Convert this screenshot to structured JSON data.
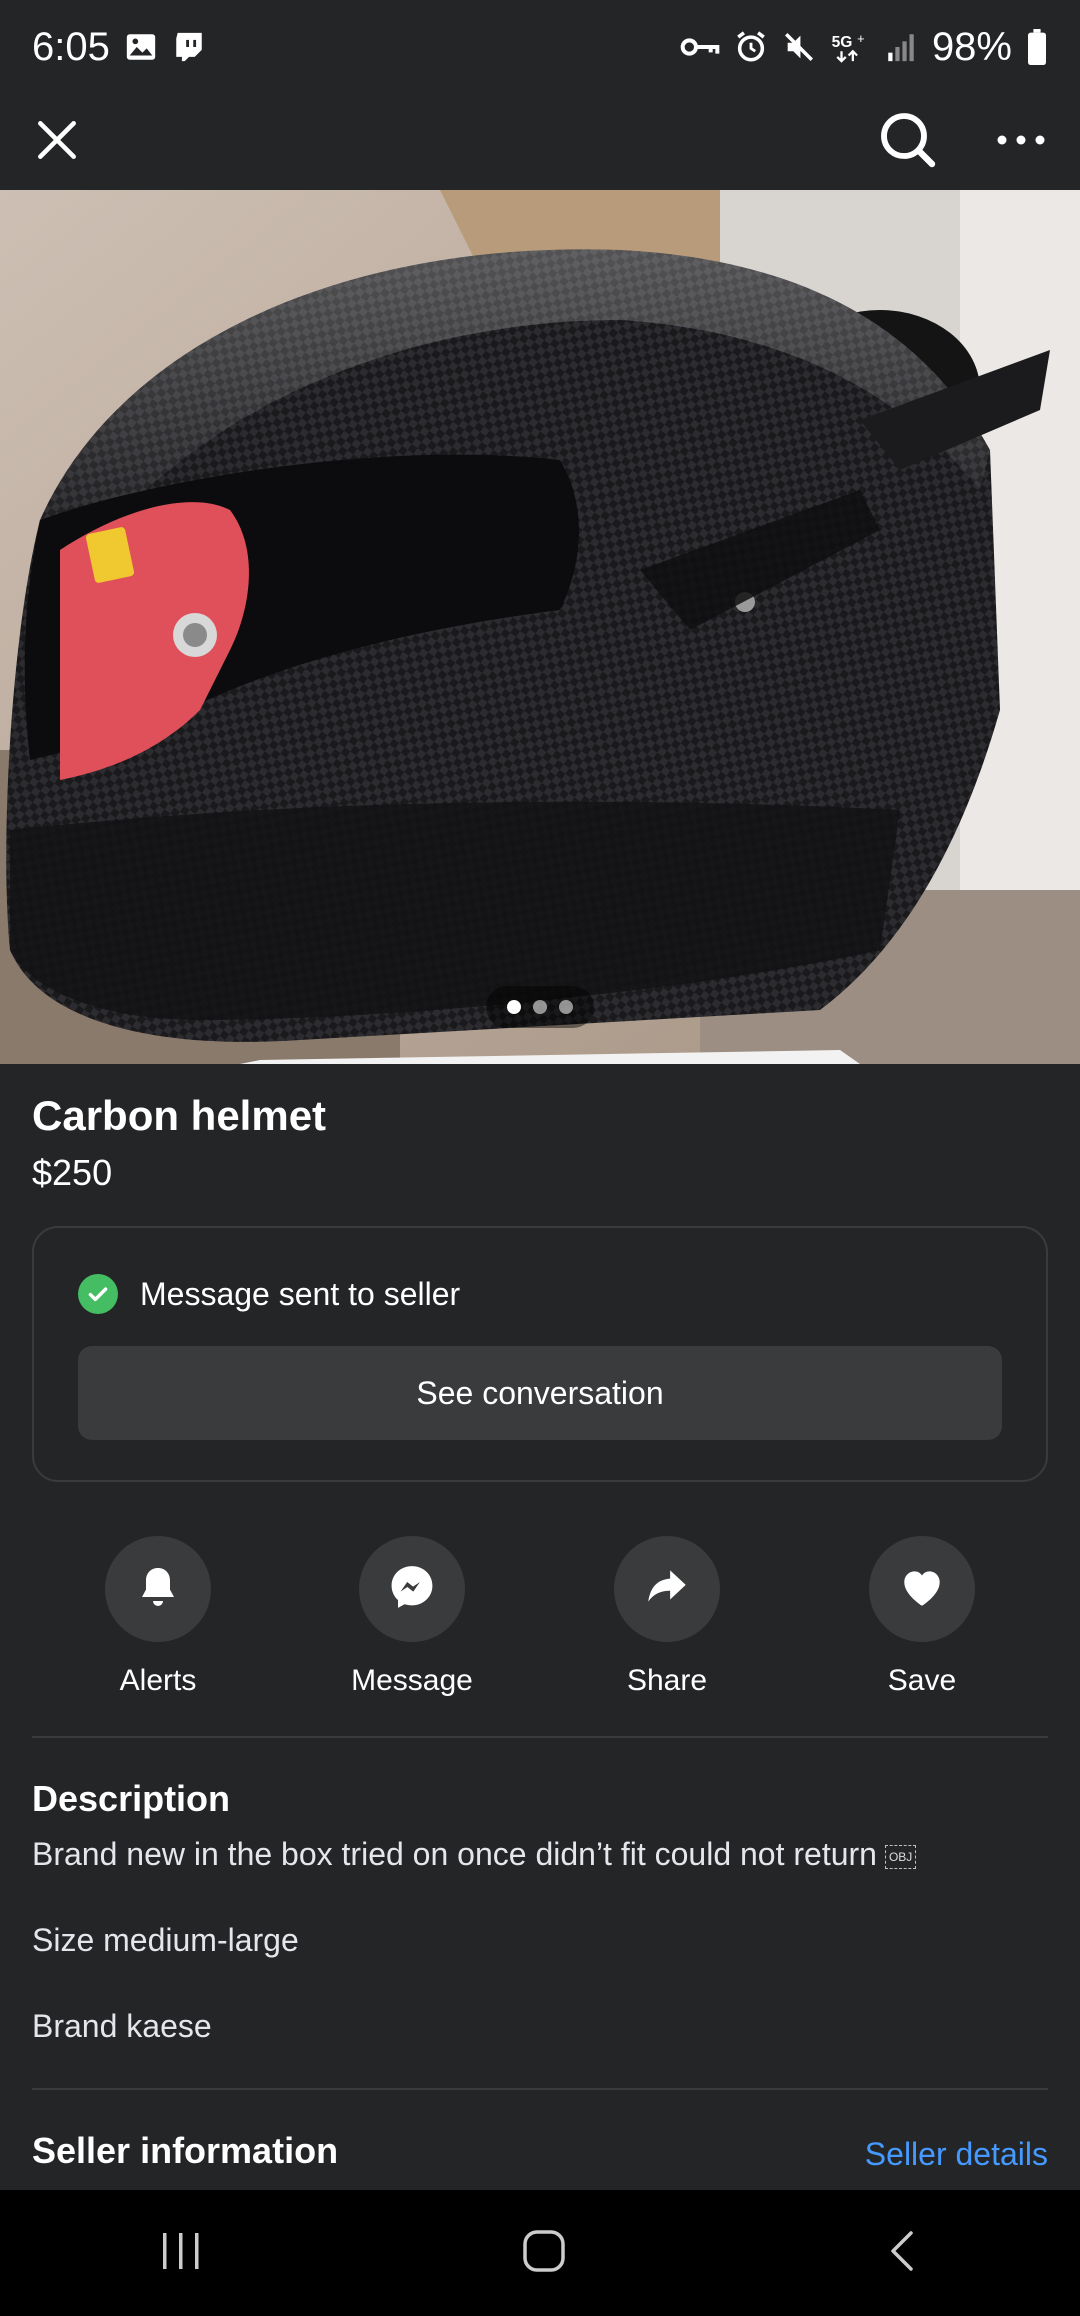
{
  "status_bar": {
    "time": "6:05",
    "battery": "98%"
  },
  "top_bar": {
    "close_icon": "close-icon",
    "search_icon": "search-icon",
    "more_icon": "more-icon"
  },
  "listing": {
    "title": "Carbon helmet",
    "price": "$250",
    "image_count": 3,
    "active_image": 1
  },
  "message_box": {
    "status": "Message sent to seller",
    "button": "See conversation"
  },
  "actions": [
    {
      "label": "Alerts",
      "icon": "bell-icon"
    },
    {
      "label": "Message",
      "icon": "messenger-icon"
    },
    {
      "label": "Share",
      "icon": "share-icon"
    },
    {
      "label": "Save",
      "icon": "heart-icon"
    }
  ],
  "description": {
    "heading": "Description",
    "lines": [
      "Brand new in the box tried on once didn’t fit could not return",
      "Size medium-large",
      "Brand kaese"
    ],
    "obj_glyph": "OBJ"
  },
  "seller": {
    "heading": "Seller information",
    "link": "Seller details"
  },
  "colors": {
    "background": "#242527",
    "accent": "#4599ff",
    "success": "#45bd62"
  }
}
